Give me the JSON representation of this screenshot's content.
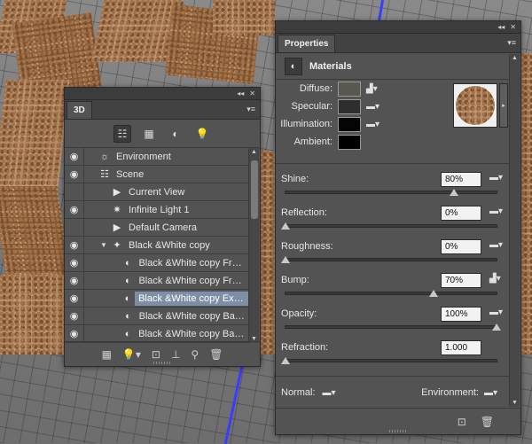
{
  "panel3d": {
    "tab": "3D",
    "topbar_collapse": "◂◂",
    "topbar_close": "✕",
    "menu": "▾≡",
    "filters": [
      {
        "icon": "scene-filter-icon",
        "glyph": "☷",
        "active": true
      },
      {
        "icon": "mesh-filter-icon",
        "glyph": "▦",
        "active": false
      },
      {
        "icon": "material-filter-icon",
        "glyph": "◐",
        "active": false
      },
      {
        "icon": "light-filter-icon",
        "glyph": "💡",
        "active": false
      }
    ],
    "layers": [
      {
        "name": "Environment",
        "indent": 0,
        "glyph": "☼",
        "eye": true,
        "twisty": "",
        "selected": false
      },
      {
        "name": "Scene",
        "indent": 0,
        "glyph": "☷",
        "eye": true,
        "twisty": "",
        "selected": false
      },
      {
        "name": "Current View",
        "indent": 1,
        "glyph": "▶",
        "eye": false,
        "twisty": "",
        "selected": false
      },
      {
        "name": "Infinite Light 1",
        "indent": 1,
        "glyph": "✷",
        "eye": true,
        "twisty": "",
        "selected": false
      },
      {
        "name": "Default Camera",
        "indent": 1,
        "glyph": "▶",
        "eye": false,
        "twisty": "",
        "selected": false
      },
      {
        "name": "Black &White copy",
        "indent": 1,
        "glyph": "✦",
        "eye": true,
        "twisty": "▼",
        "selected": false
      },
      {
        "name": "Black &White copy Front ...",
        "indent": 2,
        "glyph": "◐",
        "eye": true,
        "twisty": "",
        "selected": false
      },
      {
        "name": "Black &White copy Front ...",
        "indent": 2,
        "glyph": "◐",
        "eye": true,
        "twisty": "",
        "selected": false
      },
      {
        "name": "Black &White copy Extrus...",
        "indent": 2,
        "glyph": "◐",
        "eye": true,
        "twisty": "",
        "selected": true
      },
      {
        "name": "Black &White copy Back ...",
        "indent": 2,
        "glyph": "◐",
        "eye": true,
        "twisty": "",
        "selected": false
      },
      {
        "name": "Black &White copy Back I...",
        "indent": 2,
        "glyph": "◐",
        "eye": true,
        "twisty": "",
        "selected": false
      }
    ],
    "footer_icons": [
      "▦",
      "💡▾",
      "⊡",
      "⊥",
      "⚲",
      "🗑"
    ]
  },
  "props": {
    "tab": "Properties",
    "topbar_collapse": "◂◂",
    "topbar_close": "✕",
    "menu": "▾≡",
    "mat_glyph": "◐",
    "section_title": "Materials",
    "textures": [
      {
        "label": "Diffuse:",
        "color": "#5a5650",
        "folder": "▟▾"
      },
      {
        "label": "Specular:",
        "color": "#2e2e2e",
        "folder": "▬▾"
      },
      {
        "label": "Illumination:",
        "color": "#050505",
        "folder": "▬▾"
      },
      {
        "label": "Ambient:",
        "color": "#000000",
        "folder": ""
      }
    ],
    "preview_arrow": "▸",
    "sliders": [
      {
        "label": "Shine:",
        "value": "80%",
        "fraction": 0.8,
        "folder": "▬▾"
      },
      {
        "label": "Reflection:",
        "value": "0%",
        "fraction": 0.0,
        "folder": "▬▾"
      },
      {
        "label": "Roughness:",
        "value": "0%",
        "fraction": 0.0,
        "folder": "▬▾"
      },
      {
        "label": "Bump:",
        "value": "70%",
        "fraction": 0.7,
        "folder": "▟▾"
      },
      {
        "label": "Opacity:",
        "value": "100%",
        "fraction": 1.0,
        "folder": "▬▾"
      },
      {
        "label": "Refraction:",
        "value": "1.000",
        "fraction": 0.0,
        "folder": ""
      }
    ],
    "normal_label": "Normal:",
    "environment_label": "Environment:",
    "folder_glyph": "▬▾",
    "footer_icons": [
      "⊡",
      "🗑"
    ]
  },
  "colors": {
    "panel_bg": "#535353",
    "selection": "#7d8fa6",
    "cork": "#b78b63"
  }
}
